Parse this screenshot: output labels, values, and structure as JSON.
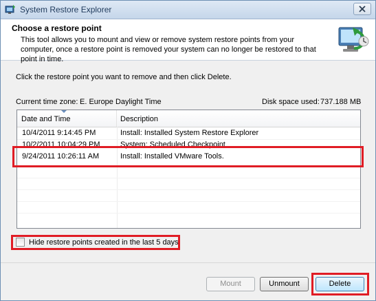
{
  "window": {
    "title": "System Restore Explorer"
  },
  "header": {
    "title": "Choose a restore point",
    "description": "This tool allows you to mount and view or remove system restore points from your computer, once a restore point is removed your system can no longer be restored to that point in time."
  },
  "instruction": "Click the restore point you want to remove and then click Delete.",
  "timezone": {
    "label": "Current time zone:",
    "value": "E. Europe Daylight Time"
  },
  "disk": {
    "label": "Disk space used:",
    "value": "737.188 MB"
  },
  "list": {
    "columns": [
      "Date and Time",
      "Description"
    ],
    "rows": [
      {
        "date": "10/4/2011 9:14:45 PM",
        "description": "Install: Installed System Restore Explorer"
      },
      {
        "date": "10/2/2011 10:04:29 PM",
        "description": "System: Scheduled Checkpoint"
      },
      {
        "date": "9/24/2011 10:26:11 AM",
        "description": "Install: Installed VMware Tools."
      }
    ],
    "selected_index": 2
  },
  "hide_recent": {
    "label": "Hide restore points created in the last 5 days",
    "checked": false
  },
  "buttons": {
    "mount": "Mount",
    "unmount": "Unmount",
    "delete": "Delete"
  },
  "colors": {
    "highlight": "#e01c24",
    "title_text": "#1e395b",
    "window_border": "#6d8fb3"
  },
  "icons": {
    "app": "system-restore-icon",
    "header": "computer-restore-icon",
    "close": "close-icon"
  }
}
